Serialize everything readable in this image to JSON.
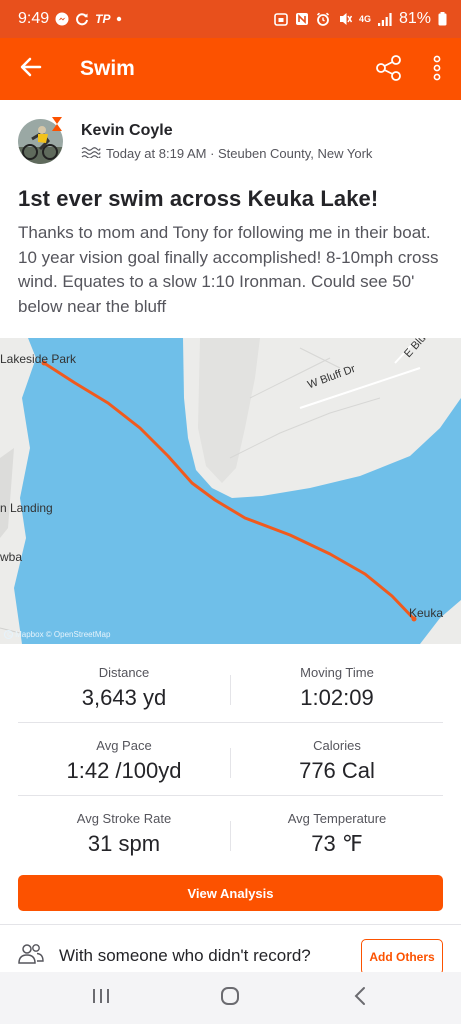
{
  "status_bar": {
    "time": "9:49",
    "tp_label": "TP",
    "network": "4G",
    "battery": "81%",
    "icons": [
      "messenger-icon",
      "sync-icon",
      "tp-icon",
      "dot-icon",
      "alarm-lock-icon",
      "nfc-icon",
      "alarm-icon",
      "vibrate-mute-icon",
      "lte-icon",
      "signal-icon",
      "battery-icon"
    ]
  },
  "app_bar": {
    "title": "Swim",
    "icons": [
      "back-arrow-icon",
      "share-icon",
      "more-vertical-icon"
    ]
  },
  "athlete": {
    "name": "Kevin Coyle",
    "meta": "Today at 8:19 AM · Steuben County, New York",
    "activity_icon": "swim-waves-icon"
  },
  "activity": {
    "title": "1st ever swim across Keuka Lake!",
    "description": "Thanks to mom and Tony for following me in their boat. 10 year vision goal finally accomplished! 8-10mph cross wind. Equates to a slow 1:10 Ironman. Could see 50' below near the bluff"
  },
  "map": {
    "labels": {
      "lakeside": "Lakeside Park",
      "landing": "n Landing",
      "wba": "wba",
      "bluff": "W Bluff Dr",
      "eblu": "E Blu",
      "keuka": "Keuka"
    },
    "attribution": "© Mapbox © OpenStreetMap",
    "route_color": "#f05a1e",
    "water_color": "#6fbfe9"
  },
  "stats": [
    {
      "label": "Distance",
      "value": "3,643 yd"
    },
    {
      "label": "Moving Time",
      "value": "1:02:09"
    },
    {
      "label": "Avg Pace",
      "value": "1:42 /100yd"
    },
    {
      "label": "Calories",
      "value": "776 Cal"
    },
    {
      "label": "Avg Stroke Rate",
      "value": "31 spm"
    },
    {
      "label": "Avg Temperature",
      "value": "73 ℉"
    }
  ],
  "actions": {
    "view_analysis": "View Analysis",
    "invite_text": "With someone who didn't record?",
    "add_others": "Add Others"
  },
  "nav_bar": {
    "icons": [
      "recents-icon",
      "home-icon",
      "back-nav-icon"
    ]
  },
  "colors": {
    "brand": "#fc5200",
    "status_bar": "#e8501c"
  }
}
